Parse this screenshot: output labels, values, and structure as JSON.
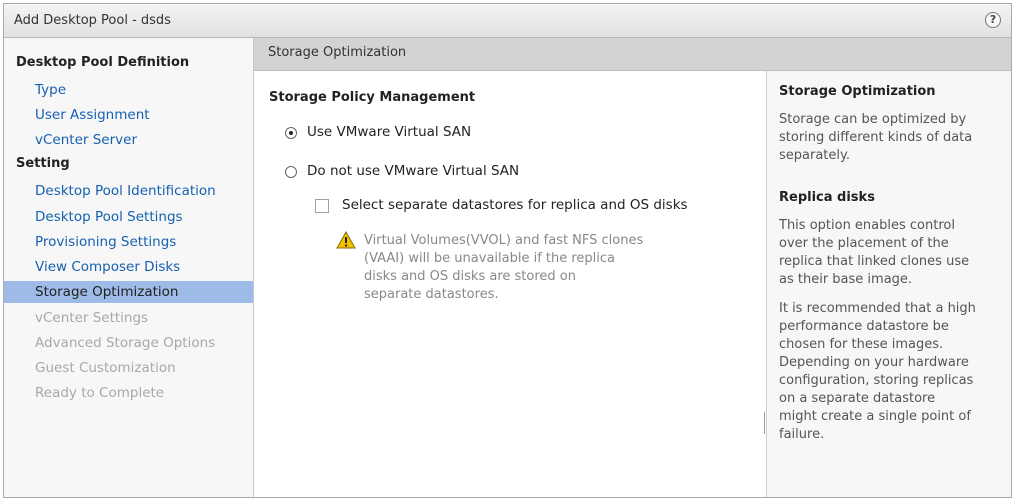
{
  "window": {
    "title": "Add Desktop Pool - dsds",
    "help_icon": "?"
  },
  "nav": {
    "section1": "Desktop Pool Definition",
    "section1_items": [
      {
        "label": "Type",
        "state": "link"
      },
      {
        "label": "User Assignment",
        "state": "link"
      },
      {
        "label": "vCenter Server",
        "state": "link"
      }
    ],
    "section2": "Setting",
    "section2_items": [
      {
        "label": "Desktop Pool Identification",
        "state": "link"
      },
      {
        "label": "Desktop Pool Settings",
        "state": "link"
      },
      {
        "label": "Provisioning Settings",
        "state": "link"
      },
      {
        "label": "View Composer Disks",
        "state": "link"
      },
      {
        "label": "Storage Optimization",
        "state": "selected"
      },
      {
        "label": "vCenter Settings",
        "state": "disabled"
      },
      {
        "label": "Advanced Storage Options",
        "state": "disabled"
      },
      {
        "label": "Guest Customization",
        "state": "disabled"
      },
      {
        "label": "Ready to Complete",
        "state": "disabled"
      }
    ]
  },
  "content": {
    "header": "Storage Optimization",
    "section_title": "Storage Policy Management",
    "option_vsan": "Use VMware Virtual SAN",
    "option_vsan_selected": true,
    "option_no_vsan": "Do not use VMware Virtual SAN",
    "option_no_vsan_selected": false,
    "checkbox_label": "Select separate datastores for replica and OS disks",
    "checkbox_checked": false,
    "warning_lines": [
      "Virtual Volumes(VVOL) and fast NFS clones",
      "(VAAI) will be unavailable if the replica",
      "disks and OS disks are stored on",
      "separate datastores."
    ]
  },
  "help_pane": {
    "title1": "Storage Optimization",
    "text1": [
      "Storage can be optimized by",
      "storing different kinds of data",
      "separately."
    ],
    "title2": "Replica disks",
    "text2": [
      "This option enables control",
      "over the placement of the",
      "replica that linked clones use",
      "as their base image."
    ],
    "text3": [
      "It is recommended that a high",
      "performance datastore be",
      "chosen for these images.",
      "Depending on your hardware",
      "configuration, storing replicas",
      "on a separate datastore",
      "might create a single point of",
      "failure."
    ]
  },
  "colors": {
    "link": "#1560b0",
    "selected_bg": "#9dbbe6",
    "disabled": "#a8a8a8",
    "warning_icon": "#f2c200"
  }
}
